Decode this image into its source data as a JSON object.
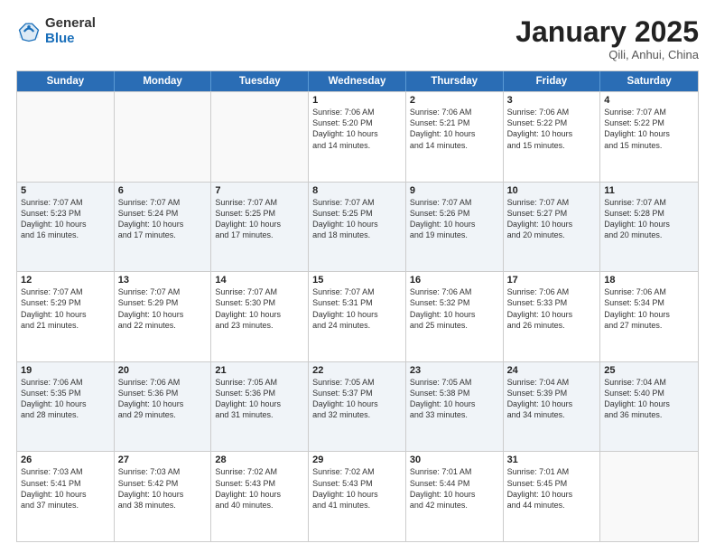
{
  "header": {
    "logo_general": "General",
    "logo_blue": "Blue",
    "month_title": "January 2025",
    "location": "Qili, Anhui, China"
  },
  "weekdays": [
    "Sunday",
    "Monday",
    "Tuesday",
    "Wednesday",
    "Thursday",
    "Friday",
    "Saturday"
  ],
  "rows": [
    {
      "alt": false,
      "cells": [
        {
          "day": "",
          "detail": ""
        },
        {
          "day": "",
          "detail": ""
        },
        {
          "day": "",
          "detail": ""
        },
        {
          "day": "1",
          "detail": "Sunrise: 7:06 AM\nSunset: 5:20 PM\nDaylight: 10 hours\nand 14 minutes."
        },
        {
          "day": "2",
          "detail": "Sunrise: 7:06 AM\nSunset: 5:21 PM\nDaylight: 10 hours\nand 14 minutes."
        },
        {
          "day": "3",
          "detail": "Sunrise: 7:06 AM\nSunset: 5:22 PM\nDaylight: 10 hours\nand 15 minutes."
        },
        {
          "day": "4",
          "detail": "Sunrise: 7:07 AM\nSunset: 5:22 PM\nDaylight: 10 hours\nand 15 minutes."
        }
      ]
    },
    {
      "alt": true,
      "cells": [
        {
          "day": "5",
          "detail": "Sunrise: 7:07 AM\nSunset: 5:23 PM\nDaylight: 10 hours\nand 16 minutes."
        },
        {
          "day": "6",
          "detail": "Sunrise: 7:07 AM\nSunset: 5:24 PM\nDaylight: 10 hours\nand 17 minutes."
        },
        {
          "day": "7",
          "detail": "Sunrise: 7:07 AM\nSunset: 5:25 PM\nDaylight: 10 hours\nand 17 minutes."
        },
        {
          "day": "8",
          "detail": "Sunrise: 7:07 AM\nSunset: 5:25 PM\nDaylight: 10 hours\nand 18 minutes."
        },
        {
          "day": "9",
          "detail": "Sunrise: 7:07 AM\nSunset: 5:26 PM\nDaylight: 10 hours\nand 19 minutes."
        },
        {
          "day": "10",
          "detail": "Sunrise: 7:07 AM\nSunset: 5:27 PM\nDaylight: 10 hours\nand 20 minutes."
        },
        {
          "day": "11",
          "detail": "Sunrise: 7:07 AM\nSunset: 5:28 PM\nDaylight: 10 hours\nand 20 minutes."
        }
      ]
    },
    {
      "alt": false,
      "cells": [
        {
          "day": "12",
          "detail": "Sunrise: 7:07 AM\nSunset: 5:29 PM\nDaylight: 10 hours\nand 21 minutes."
        },
        {
          "day": "13",
          "detail": "Sunrise: 7:07 AM\nSunset: 5:29 PM\nDaylight: 10 hours\nand 22 minutes."
        },
        {
          "day": "14",
          "detail": "Sunrise: 7:07 AM\nSunset: 5:30 PM\nDaylight: 10 hours\nand 23 minutes."
        },
        {
          "day": "15",
          "detail": "Sunrise: 7:07 AM\nSunset: 5:31 PM\nDaylight: 10 hours\nand 24 minutes."
        },
        {
          "day": "16",
          "detail": "Sunrise: 7:06 AM\nSunset: 5:32 PM\nDaylight: 10 hours\nand 25 minutes."
        },
        {
          "day": "17",
          "detail": "Sunrise: 7:06 AM\nSunset: 5:33 PM\nDaylight: 10 hours\nand 26 minutes."
        },
        {
          "day": "18",
          "detail": "Sunrise: 7:06 AM\nSunset: 5:34 PM\nDaylight: 10 hours\nand 27 minutes."
        }
      ]
    },
    {
      "alt": true,
      "cells": [
        {
          "day": "19",
          "detail": "Sunrise: 7:06 AM\nSunset: 5:35 PM\nDaylight: 10 hours\nand 28 minutes."
        },
        {
          "day": "20",
          "detail": "Sunrise: 7:06 AM\nSunset: 5:36 PM\nDaylight: 10 hours\nand 29 minutes."
        },
        {
          "day": "21",
          "detail": "Sunrise: 7:05 AM\nSunset: 5:36 PM\nDaylight: 10 hours\nand 31 minutes."
        },
        {
          "day": "22",
          "detail": "Sunrise: 7:05 AM\nSunset: 5:37 PM\nDaylight: 10 hours\nand 32 minutes."
        },
        {
          "day": "23",
          "detail": "Sunrise: 7:05 AM\nSunset: 5:38 PM\nDaylight: 10 hours\nand 33 minutes."
        },
        {
          "day": "24",
          "detail": "Sunrise: 7:04 AM\nSunset: 5:39 PM\nDaylight: 10 hours\nand 34 minutes."
        },
        {
          "day": "25",
          "detail": "Sunrise: 7:04 AM\nSunset: 5:40 PM\nDaylight: 10 hours\nand 36 minutes."
        }
      ]
    },
    {
      "alt": false,
      "cells": [
        {
          "day": "26",
          "detail": "Sunrise: 7:03 AM\nSunset: 5:41 PM\nDaylight: 10 hours\nand 37 minutes."
        },
        {
          "day": "27",
          "detail": "Sunrise: 7:03 AM\nSunset: 5:42 PM\nDaylight: 10 hours\nand 38 minutes."
        },
        {
          "day": "28",
          "detail": "Sunrise: 7:02 AM\nSunset: 5:43 PM\nDaylight: 10 hours\nand 40 minutes."
        },
        {
          "day": "29",
          "detail": "Sunrise: 7:02 AM\nSunset: 5:43 PM\nDaylight: 10 hours\nand 41 minutes."
        },
        {
          "day": "30",
          "detail": "Sunrise: 7:01 AM\nSunset: 5:44 PM\nDaylight: 10 hours\nand 42 minutes."
        },
        {
          "day": "31",
          "detail": "Sunrise: 7:01 AM\nSunset: 5:45 PM\nDaylight: 10 hours\nand 44 minutes."
        },
        {
          "day": "",
          "detail": ""
        }
      ]
    }
  ]
}
